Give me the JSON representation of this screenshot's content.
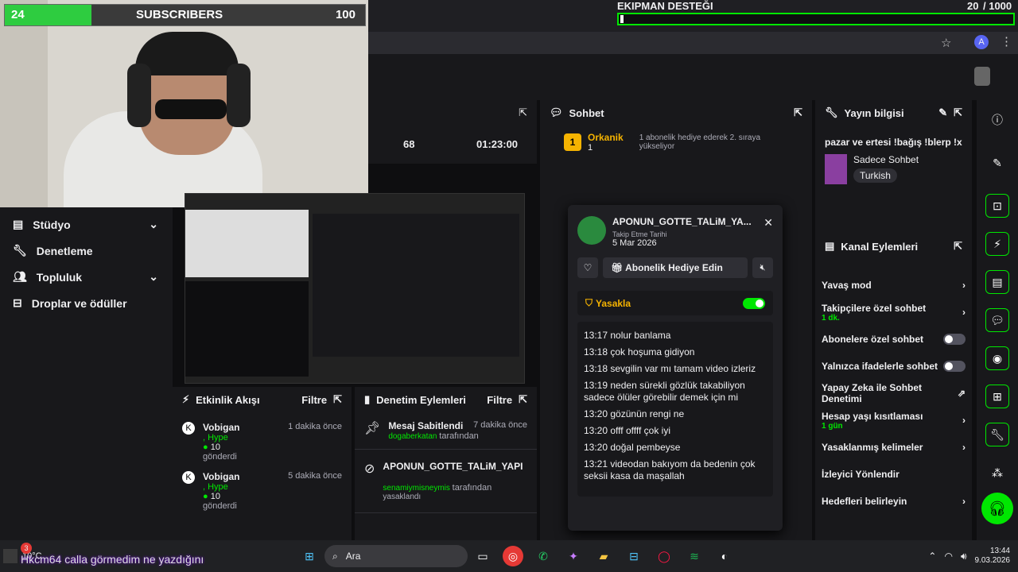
{
  "subs": {
    "current": "24",
    "label": "SUBSCRIBERS",
    "goal": "100",
    "progress": 0.24
  },
  "alert": {
    "title": "EKIPMAN DESTEĞI",
    "count": "20",
    "total": "/ 1000"
  },
  "leftnav": {
    "items": [
      {
        "label": "Stüdyo"
      },
      {
        "label": "Denetleme"
      },
      {
        "label": "Topluluk"
      },
      {
        "label": "Droplar ve ödüller"
      }
    ]
  },
  "stats": {
    "a": "68",
    "b": "01:23:00"
  },
  "activity": {
    "title": "Etkinlik Akışı",
    "filter": "Filtre",
    "events": [
      {
        "user": "Vobigan",
        "type": ", Hype",
        "amount": "10",
        "verb": "gönderdi",
        "time": "1 dakika önce"
      },
      {
        "user": "Vobigan",
        "type": ", Hype",
        "amount": "10",
        "verb": "gönderdi",
        "time": "5 dakika önce"
      }
    ]
  },
  "moderation": {
    "title": "Denetim Eylemleri",
    "filter": "Filtre",
    "items": [
      {
        "title": "Mesaj Sabitlendi",
        "time": "7 dakika önce",
        "by": "dogaberkatan",
        "byword": "tarafından"
      },
      {
        "title": "APONUN_GOTTE_TALiM_YAPI",
        "by": "senamiymisneymis",
        "byword": "tarafından",
        "action": "yasaklandı"
      }
    ]
  },
  "chat": {
    "title": "Sohbet",
    "leader_name": "Orkanik",
    "leader_count": "1",
    "leader_msg": "1 abonelik hediye ederek 2. sıraya yükseliyor"
  },
  "popup": {
    "username": "APONUN_GOTTE_TALiM_YA...",
    "follow_label": "Takip Etme Tarihi",
    "follow_date": "5 Mar 2026",
    "gift_label": "Abonelik Hediye Edin",
    "ban_label": "Yasakla",
    "messages": [
      {
        "t": "13:17",
        "m": "nolur banlama"
      },
      {
        "t": "13:18",
        "m": "çok hoşuma gidiyon"
      },
      {
        "t": "13:18",
        "m": "sevgilin var mı tamam video izleriz"
      },
      {
        "t": "13:19",
        "m": "neden sürekli gözlük takabiliyon sadece ölüler görebilir demek için mi"
      },
      {
        "t": "13:20",
        "m": "gözünün rengi ne"
      },
      {
        "t": "13:20",
        "m": "offf offff çok iyi"
      },
      {
        "t": "13:20",
        "m": "doğal pembeyse"
      },
      {
        "t": "13:21",
        "m": "videodan bakıyom da bedenin çok seksii kasa da maşallah"
      }
    ]
  },
  "streaminfo": {
    "title": "Yayın bilgisi",
    "stream_title": "pazar ve ertesi !bağış !blerp !x",
    "category": "Sadece Sohbet",
    "tag": "Turkish"
  },
  "channel": {
    "title": "Kanal Eylemleri",
    "items": [
      {
        "label": "Yavaş mod"
      },
      {
        "label": "Takipçilere özel sohbet",
        "sub": "1 dk."
      },
      {
        "label": "Abonelere özel sohbet"
      },
      {
        "label": "Yalnızca ifadelerle sohbet"
      },
      {
        "label": "Yapay Zeka ile Sohbet Denetimi"
      },
      {
        "label": "Hesap yaşı kısıtlaması",
        "sub": "1 gün"
      },
      {
        "label": "Yasaklanmış kelimeler"
      },
      {
        "label": "İzleyici Yönlendir"
      },
      {
        "label": "Hedefleri belirleyin"
      }
    ]
  },
  "taskbar": {
    "temp": "10°C",
    "badge": "3",
    "ticker": "Hkcm64 calla görmedim ne yazdığını",
    "search": "Ara",
    "time": "13:44",
    "date": "9.03.2026"
  },
  "colors": {
    "accent": "#00e701",
    "bg": "#0e0e10",
    "panel": "#18181b"
  }
}
